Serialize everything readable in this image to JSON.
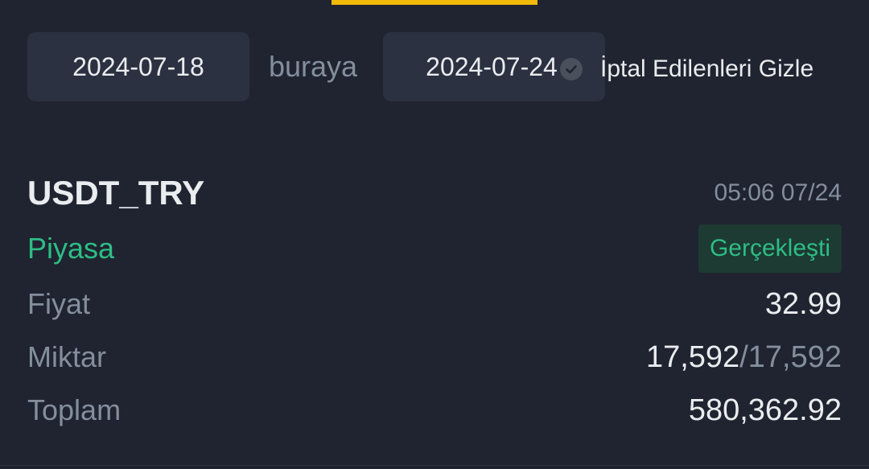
{
  "filters": {
    "start_date": "2024-07-18",
    "separator": "buraya",
    "end_date": "2024-07-24",
    "hide_cancelled_label": "İptal Edilenleri Gizle"
  },
  "order": {
    "symbol": "USDT_TRY",
    "time": "05:06 07/24",
    "type": "Piyasa",
    "status": "Gerçekleşti",
    "price_label": "Fiyat",
    "price_value": "32.99",
    "amount_label": "Miktar",
    "amount_filled": "17,592",
    "amount_separator": "/",
    "amount_total": "17,592",
    "total_label": "Toplam",
    "total_value": "580,362.92"
  },
  "colors": {
    "accent": "#f0b90b",
    "positive": "#2ebd85",
    "background": "#1f2430"
  },
  "icons": {
    "hide_cancelled": "check-circle-icon"
  }
}
